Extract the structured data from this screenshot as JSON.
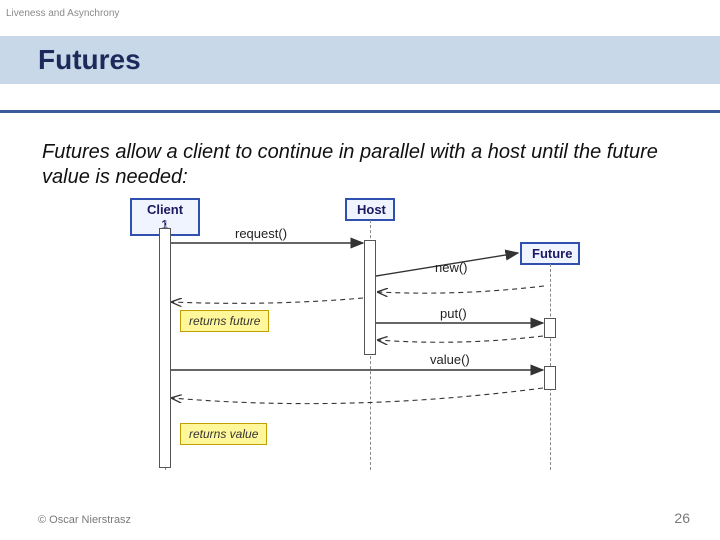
{
  "topic": "Liveness and Asynchrony",
  "title": "Futures",
  "body": "Futures allow a client to continue in parallel with a host until the future value is needed:",
  "diagram": {
    "objects": {
      "client": "Client 1",
      "host": "Host",
      "future": "Future"
    },
    "messages": {
      "request": "request()",
      "new": "new()",
      "put": "put()",
      "value": "value()"
    },
    "notes": {
      "returns_future": "returns future",
      "returns_value": "returns value"
    }
  },
  "footer": {
    "copyright": "© Oscar Nierstrasz",
    "page": "26"
  },
  "chart_data": {
    "type": "sequence-diagram",
    "participants": [
      "Client 1",
      "Host",
      "Future"
    ],
    "events": [
      {
        "from": "Client 1",
        "to": "Host",
        "label": "request()",
        "kind": "call"
      },
      {
        "from": "Host",
        "to": "Future",
        "label": "new()",
        "kind": "create"
      },
      {
        "from": "Host",
        "to": "Client 1",
        "label": "returns future",
        "kind": "return"
      },
      {
        "from": "Host",
        "to": "Future",
        "label": "put()",
        "kind": "call"
      },
      {
        "from": "Client 1",
        "to": "Future",
        "label": "value()",
        "kind": "call"
      },
      {
        "from": "Future",
        "to": "Client 1",
        "label": "returns value",
        "kind": "return"
      }
    ]
  }
}
